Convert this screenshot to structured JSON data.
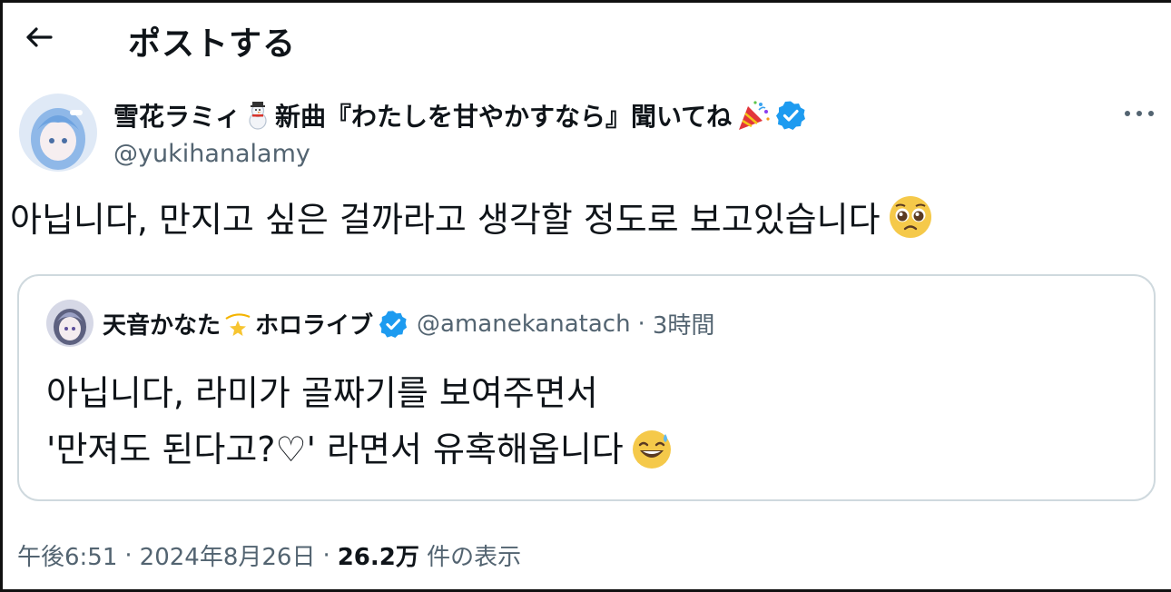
{
  "header": {
    "back_icon": "arrow-left-icon",
    "title": "ポストする"
  },
  "author": {
    "avatar_icon": "avatar-lamy",
    "name_prefix": "雪花ラミィ",
    "name_emoji1": "snowman-icon",
    "name_suffix": "新曲『わたしを甘やかすなら』聞いてね",
    "name_emoji2": "party-popper-icon",
    "verified_icon": "verified-badge-icon",
    "handle": "@yukihanalamy",
    "more_icon": "more-horizontal-icon"
  },
  "tweet": {
    "text": "아닙니다, 만지고 싶은 걸까라고 생각할 정도로 보고있습니다",
    "emoji": "pleading-face-icon"
  },
  "quote": {
    "avatar_icon": "avatar-kanata",
    "name_prefix": "天音かなた",
    "name_emoji": "dizzy-star-icon",
    "name_suffix": "ホロライブ",
    "verified_icon": "verified-badge-icon",
    "handle": "@amanekanatach",
    "separator": "·",
    "time": "3時間",
    "line1": "아닙니다, 라미가 골짜기를 보여주면서",
    "line2": "'만져도 된다고?♡' 라면서 유혹해옵니다",
    "emoji": "sweat-smile-icon"
  },
  "meta": {
    "time": "午後6:51",
    "sep1": "·",
    "date": "2024年8月26日",
    "sep2": "·",
    "views": "26.2万",
    "views_label": "件の表示"
  },
  "colors": {
    "text": "#0f1419",
    "secondary": "#536471",
    "border": "#cfd9de",
    "verified": "#1d9bf0"
  }
}
